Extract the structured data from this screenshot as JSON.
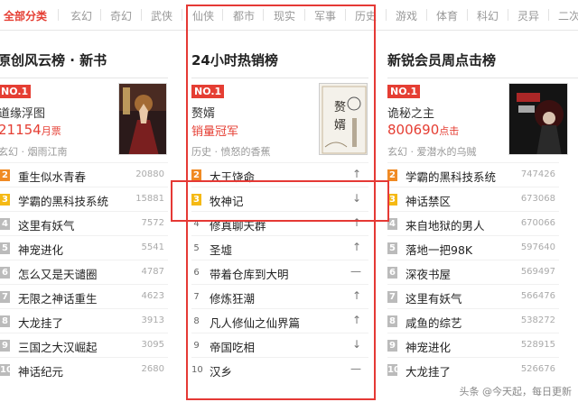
{
  "nav": {
    "categories": [
      {
        "label": "全部分类",
        "active": true
      },
      {
        "label": "玄幻"
      },
      {
        "label": "奇幻"
      },
      {
        "label": "武侠"
      },
      {
        "label": "仙侠"
      },
      {
        "label": "都市"
      },
      {
        "label": "现实"
      },
      {
        "label": "军事"
      },
      {
        "label": "历史"
      },
      {
        "label": "游戏"
      },
      {
        "label": "体育"
      },
      {
        "label": "科幻"
      },
      {
        "label": "灵异"
      },
      {
        "label": "二次"
      }
    ]
  },
  "columns": [
    {
      "title": "原创风云榜 · 新书",
      "top": {
        "badge": "NO.1",
        "name": "道缘浮图",
        "number": "21154",
        "unit": "月票",
        "meta": "玄幻 · 烟雨江南"
      },
      "items": [
        {
          "rank": "2",
          "name": "重生似水青春",
          "value": "20880"
        },
        {
          "rank": "3",
          "name": "学霸的黑科技系统",
          "value": "15881"
        },
        {
          "rank": "4",
          "name": "这里有妖气",
          "value": "7572"
        },
        {
          "rank": "5",
          "name": "神宠进化",
          "value": "5541"
        },
        {
          "rank": "6",
          "name": "怎么又是天谴圈",
          "value": "4787"
        },
        {
          "rank": "7",
          "name": "无限之神话重生",
          "value": "4623"
        },
        {
          "rank": "8",
          "name": "大龙挂了",
          "value": "3913"
        },
        {
          "rank": "9",
          "name": "三国之大汉崛起",
          "value": "3095"
        },
        {
          "rank": "10",
          "name": "神话纪元",
          "value": "2680"
        }
      ]
    },
    {
      "title": "24小时热销榜",
      "top": {
        "badge": "NO.1",
        "name": "赘婿",
        "number": "销量冠军",
        "unit": "",
        "meta": "历史 · 愤怒的香蕉"
      },
      "items": [
        {
          "rank": "2",
          "name": "大王饶命",
          "value": "↑"
        },
        {
          "rank": "3",
          "name": "牧神记",
          "value": "↓"
        },
        {
          "rank": "4",
          "name": "修真聊天群",
          "value": "↑"
        },
        {
          "rank": "5",
          "name": "圣墟",
          "value": "↑"
        },
        {
          "rank": "6",
          "name": "带着仓库到大明",
          "value": "—"
        },
        {
          "rank": "7",
          "name": "修炼狂潮",
          "value": "↑"
        },
        {
          "rank": "8",
          "name": "凡人修仙之仙界篇",
          "value": "↑"
        },
        {
          "rank": "9",
          "name": "帝国吃相",
          "value": "↓"
        },
        {
          "rank": "10",
          "name": "汉乡",
          "value": "—"
        }
      ]
    },
    {
      "title": "新锐会员周点击榜",
      "top": {
        "badge": "NO.1",
        "name": "诡秘之主",
        "number": "800690",
        "unit": "点击",
        "meta": "玄幻 · 爱潜水的乌贼"
      },
      "items": [
        {
          "rank": "2",
          "name": "学霸的黑科技系统",
          "value": "747426"
        },
        {
          "rank": "3",
          "name": "神话禁区",
          "value": "673068"
        },
        {
          "rank": "4",
          "name": "来自地狱的男人",
          "value": "670066"
        },
        {
          "rank": "5",
          "name": "落地一把98K",
          "value": "597640"
        },
        {
          "rank": "6",
          "name": "深夜书屋",
          "value": "569497"
        },
        {
          "rank": "7",
          "name": "这里有妖气",
          "value": "566476"
        },
        {
          "rank": "8",
          "name": "咸鱼的综艺",
          "value": "538272"
        },
        {
          "rank": "9",
          "name": "神宠进化",
          "value": "528915"
        },
        {
          "rank": "10",
          "name": "大龙挂了",
          "value": "526676"
        }
      ]
    }
  ],
  "watermark": "头条 @今天起，每日更新",
  "colors": {
    "accent": "#e53e33",
    "highlight_box": "#e53935",
    "rank2": "#f08a24",
    "rank3": "#f5b914"
  }
}
